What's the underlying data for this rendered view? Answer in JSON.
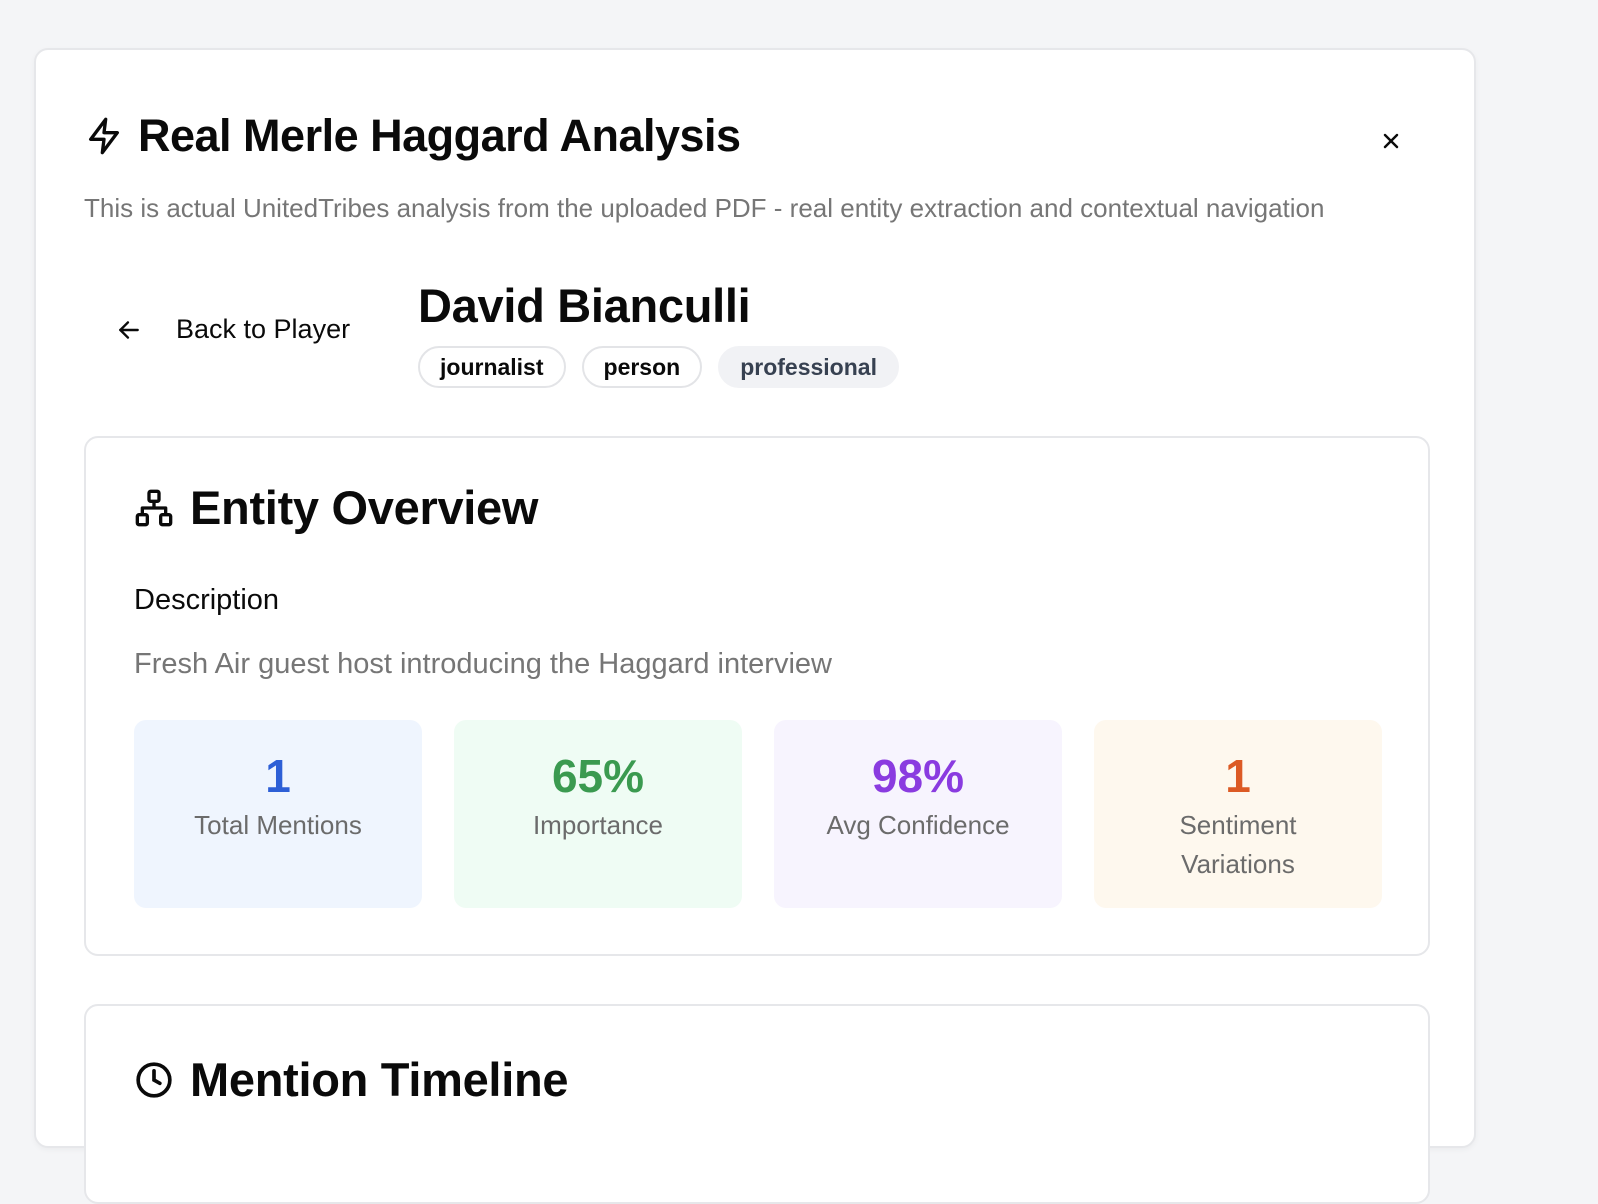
{
  "modal": {
    "title": "Real Merle Haggard Analysis",
    "subtitle": "This is actual UnitedTribes analysis from the uploaded PDF - real entity extraction and contextual navigation",
    "close_label": "×"
  },
  "nav": {
    "back_label": "Back to Player"
  },
  "entity": {
    "name": "David Bianculli",
    "tags": [
      "journalist",
      "person",
      "professional"
    ]
  },
  "overview": {
    "title": "Entity Overview",
    "description_label": "Description",
    "description": "Fresh Air guest host introducing the Haggard interview",
    "stats": [
      {
        "value": "1",
        "label": "Total Mentions",
        "color": "#2d5fd6"
      },
      {
        "value": "65%",
        "label": "Importance",
        "color": "#3b9a50"
      },
      {
        "value": "98%",
        "label": "Avg Confidence",
        "color": "#8a3be0"
      },
      {
        "value": "1",
        "label": "Sentiment Variations",
        "color": "#dc5a24"
      }
    ]
  },
  "timeline": {
    "title": "Mention Timeline"
  },
  "icons": {
    "title": "bolt-icon",
    "close": "close-icon",
    "back": "arrow-left-icon",
    "overview": "network-icon",
    "timeline": "clock-icon"
  }
}
